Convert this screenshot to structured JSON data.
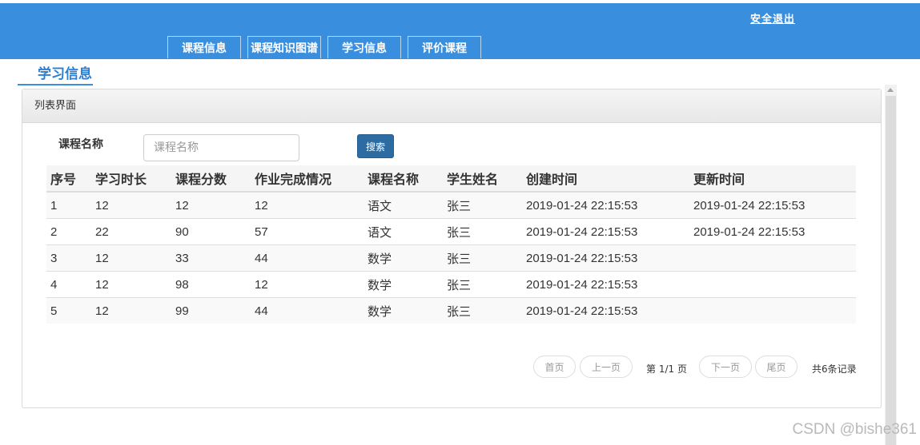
{
  "header": {
    "logout_label": "安全退出",
    "tabs": [
      {
        "label": "课程信息"
      },
      {
        "label": "课程知识图谱"
      },
      {
        "label": "学习信息"
      },
      {
        "label": "评价课程"
      }
    ]
  },
  "page": {
    "title": "学习信息"
  },
  "panel": {
    "title": "列表界面",
    "search": {
      "label": "课程名称",
      "placeholder": "课程名称",
      "value": "",
      "button_label": "搜索"
    }
  },
  "table": {
    "columns": [
      "序号",
      "学习时长",
      "课程分数",
      "作业完成情况",
      "课程名称",
      "学生姓名",
      "创建时间",
      "更新时间"
    ],
    "rows": [
      [
        "1",
        "12",
        "12",
        "12",
        "语文",
        "张三",
        "2019-01-24 22:15:53",
        "2019-01-24 22:15:53"
      ],
      [
        "2",
        "22",
        "90",
        "57",
        "语文",
        "张三",
        "2019-01-24 22:15:53",
        "2019-01-24 22:15:53"
      ],
      [
        "3",
        "12",
        "33",
        "44",
        "数学",
        "张三",
        "2019-01-24 22:15:53",
        ""
      ],
      [
        "4",
        "12",
        "98",
        "12",
        "数学",
        "张三",
        "2019-01-24 22:15:53",
        ""
      ],
      [
        "5",
        "12",
        "99",
        "44",
        "数学",
        "张三",
        "2019-01-24 22:15:53",
        ""
      ]
    ]
  },
  "pagination": {
    "first_label": "首页",
    "prev_label": "上一页",
    "page_info": "第 1/1 页",
    "next_label": "下一页",
    "last_label": "尾页",
    "total_label": "共6条记录"
  },
  "watermark": "CSDN @bishe361",
  "colors": {
    "header_bg": "#3a8ede",
    "title_accent": "#2a7fd3",
    "search_button": "#2d6ca2"
  }
}
